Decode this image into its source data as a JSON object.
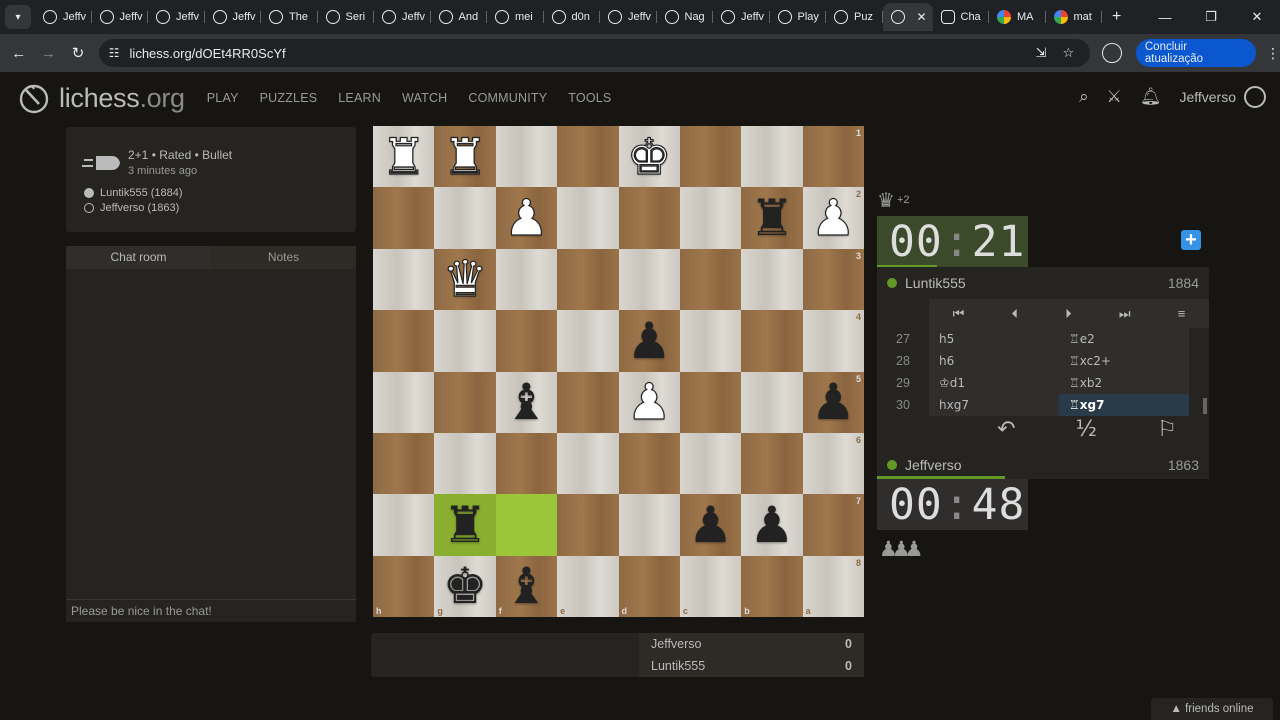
{
  "browser": {
    "tabs": [
      {
        "title": "Jeffv",
        "icon": "lichess"
      },
      {
        "title": "Jeffv",
        "icon": "lichess"
      },
      {
        "title": "Jeffv",
        "icon": "lichess"
      },
      {
        "title": "Jeffv",
        "icon": "lichess"
      },
      {
        "title": "The",
        "icon": "lichess"
      },
      {
        "title": "Seri",
        "icon": "lichess"
      },
      {
        "title": "Jeffv",
        "icon": "lichess"
      },
      {
        "title": "And",
        "icon": "lichess"
      },
      {
        "title": "mei",
        "icon": "lichess"
      },
      {
        "title": "d0n",
        "icon": "lichess"
      },
      {
        "title": "Jeffv",
        "icon": "lichess"
      },
      {
        "title": "Nag",
        "icon": "lichess"
      },
      {
        "title": "Jeffv",
        "icon": "lichess"
      },
      {
        "title": "Play",
        "icon": "lichess"
      },
      {
        "title": "Puz",
        "icon": "lichess"
      }
    ],
    "active_tab_close": "✕",
    "tabs_after": [
      {
        "title": "Cha",
        "icon": "chatgpt"
      },
      {
        "title": "MA",
        "icon": "google"
      },
      {
        "title": "mat",
        "icon": "google"
      }
    ],
    "url": "lichess.org/dOEt4RR0ScYf",
    "update_button": "Concluir atualização"
  },
  "site": {
    "logo_main": "lichess",
    "logo_tld": ".org",
    "nav": [
      "PLAY",
      "PUZZLES",
      "LEARN",
      "WATCH",
      "COMMUNITY",
      "TOOLS"
    ],
    "username": "Jeffverso"
  },
  "game": {
    "setup": "2+1 • Rated • Bullet",
    "time_ago": "3 minutes ago",
    "white_player": "Luntik555 (1884)",
    "black_player": "Jeffverso (1863)"
  },
  "chat": {
    "tab_chat": "Chat room",
    "tab_notes": "Notes",
    "placeholder": "Please be nice in the chat!"
  },
  "board": {
    "rows": [
      [
        "R",
        "R",
        "",
        "",
        "K",
        "",
        "",
        ""
      ],
      [
        "",
        "",
        "P",
        "",
        "",
        "",
        "r",
        "P"
      ],
      [
        "",
        "Q",
        "",
        "",
        "",
        "",
        "",
        ""
      ],
      [
        "",
        "",
        "",
        "",
        "p",
        "",
        "",
        ""
      ],
      [
        "",
        "",
        "b",
        "",
        "P",
        "",
        "",
        "p"
      ],
      [
        "",
        "",
        "",
        "",
        "",
        "",
        "",
        ""
      ],
      [
        "",
        "r",
        "",
        "",
        "",
        "p",
        "p",
        ""
      ],
      [
        "",
        "k",
        "b",
        "",
        "",
        "",
        "",
        ""
      ]
    ],
    "ranks": [
      "1",
      "2",
      "3",
      "4",
      "5",
      "6",
      "7",
      "8"
    ],
    "files": [
      "h",
      "g",
      "f",
      "e",
      "d",
      "c",
      "b",
      "a"
    ],
    "highlight": [
      [
        6,
        1
      ],
      [
        6,
        2
      ]
    ]
  },
  "opponent": {
    "name": "Luntik555",
    "rating": "1884",
    "clock_min": "00",
    "clock_sec": "21",
    "material": "+2",
    "time_fraction": 0.4
  },
  "me": {
    "name": "Jeffverso",
    "rating": "1863",
    "clock_min": "00",
    "clock_sec": "48",
    "time_fraction": 0.85
  },
  "moves": [
    {
      "n": "27",
      "w": "h5",
      "b": "♖e2"
    },
    {
      "n": "28",
      "w": "h6",
      "b": "♖xc2+"
    },
    {
      "n": "29",
      "w": "♔d1",
      "b": "♖xb2"
    },
    {
      "n": "30",
      "w": "hxg7",
      "b": "♖xg7"
    }
  ],
  "controls": [
    "⏮",
    "⏴",
    "⏵",
    "⏭",
    "≡"
  ],
  "actions": {
    "takeback": "↶",
    "draw": "½",
    "resign": "⚐"
  },
  "material_bottom": "♟♟♟",
  "scores": [
    {
      "name": "Jeffverso",
      "score": "0"
    },
    {
      "name": "Luntik555",
      "score": "0"
    }
  ],
  "friends": "friends online"
}
